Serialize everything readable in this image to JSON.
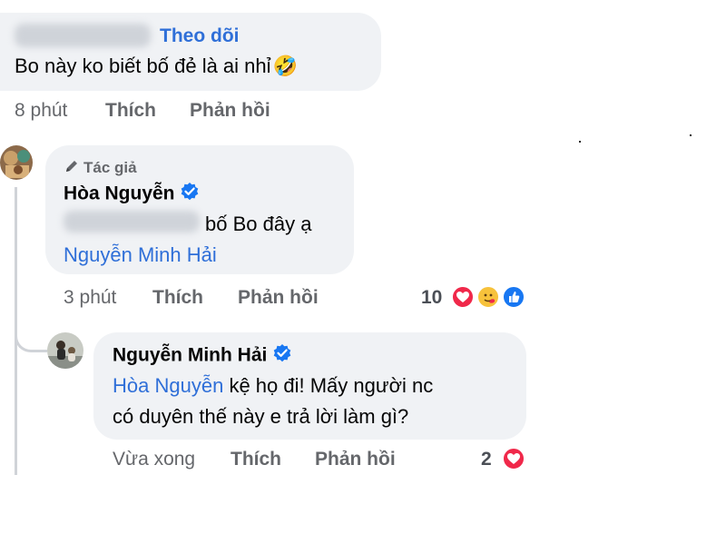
{
  "comment1": {
    "follow_label": "Theo dõi",
    "text": "Bo này ko biết bố đẻ là ai nhỉ",
    "emoji": "🤣",
    "time": "8 phút",
    "like": "Thích",
    "reply": "Phản hồi"
  },
  "comment2": {
    "author_badge": "Tác giả",
    "name": "Hòa Nguyễn",
    "text": "bố Bo đây ạ",
    "mention": "Nguyễn Minh Hải",
    "time": "3 phút",
    "like": "Thích",
    "reply": "Phản hồi",
    "reaction_count": "10"
  },
  "comment3": {
    "name": "Nguyễn Minh Hải",
    "mention": "Hòa Nguyễn",
    "text_line1": "kệ họ đi! Mấy người nc",
    "text_line2": "có duyên thế này e trả lời làm gì?",
    "time": "Vừa xong",
    "like": "Thích",
    "reply": "Phản hồi",
    "reaction_count": "2"
  },
  "colors": {
    "bubble": "#f0f2f5",
    "link_blue": "#2f6fd8",
    "meta_gray": "#65676b",
    "verified_blue": "#1877f2",
    "love_red": "#f0284a"
  }
}
